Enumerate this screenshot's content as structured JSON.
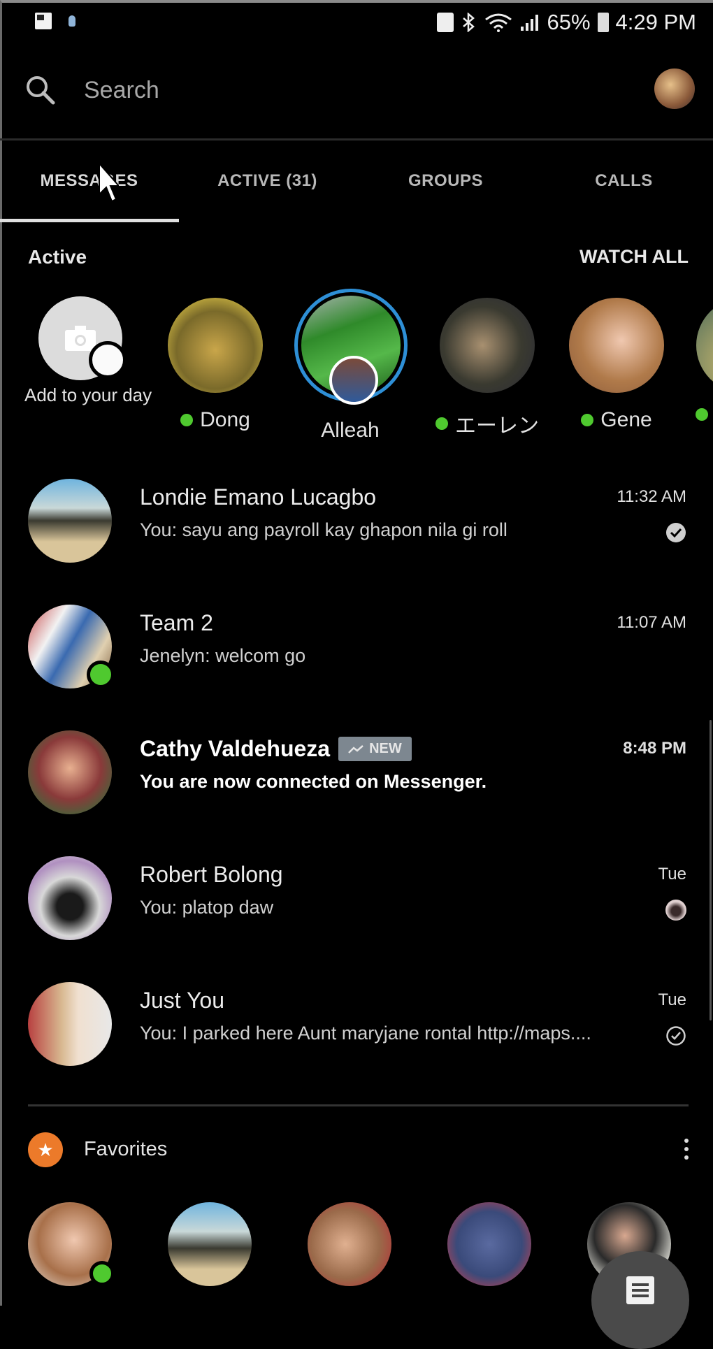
{
  "status_bar": {
    "battery": "65%",
    "time": "4:29 PM",
    "left_icons": [
      "image-notification-icon",
      "location-pin-icon"
    ],
    "right_icons": [
      "lock-icon",
      "bluetooth-off-icon",
      "wifi-icon",
      "signal-icon",
      "battery-icon"
    ]
  },
  "search": {
    "placeholder": "Search",
    "value": ""
  },
  "tabs": [
    {
      "label": "MESSAGES",
      "active": true
    },
    {
      "label": "ACTIVE (31)",
      "active": false
    },
    {
      "label": "GROUPS",
      "active": false
    },
    {
      "label": "CALLS",
      "active": false
    }
  ],
  "active_section": {
    "title": "Active",
    "watch_all_label": "WATCH ALL",
    "stories": [
      {
        "name": "Add to your day",
        "online": false,
        "type": "add"
      },
      {
        "name": "Dong",
        "online": true
      },
      {
        "name": "Alleah",
        "online": false,
        "has_story": true
      },
      {
        "name": "エーレン",
        "online": true
      },
      {
        "name": "Gene",
        "online": true
      },
      {
        "name": "",
        "online": true
      }
    ]
  },
  "conversations": [
    {
      "name": "Londie Emano Lucagbo",
      "snippet": "You: sayu ang payroll kay ghapon nila gi roll",
      "time": "11:32 AM",
      "status": "delivered",
      "unread": false,
      "online": false
    },
    {
      "name": "Team 2",
      "snippet": "Jenelyn: welcom go",
      "time": "11:07 AM",
      "status": "",
      "unread": false,
      "online": true
    },
    {
      "name": "Cathy Valdehueza",
      "badge": "NEW",
      "snippet": "You are now connected on Messenger.",
      "time": "8:48 PM",
      "status": "",
      "unread": true,
      "online": false
    },
    {
      "name": "Robert Bolong",
      "snippet": "You: platop daw",
      "time": "Tue",
      "status": "seen",
      "unread": false,
      "online": false
    },
    {
      "name": "Just You",
      "snippet": "You: I parked here Aunt maryjane rontal http://maps....",
      "time": "Tue",
      "status": "sent",
      "unread": false,
      "online": false
    }
  ],
  "favorites": {
    "title": "Favorites",
    "items": [
      {
        "online": true
      },
      {
        "online": false
      },
      {
        "online": false
      },
      {
        "online": false
      },
      {
        "online": false
      }
    ]
  },
  "colors": {
    "online": "#4fc92f",
    "story_ring": "#2e8fd6",
    "favorites_accent": "#ec7a2a",
    "new_badge": "#7d8790"
  }
}
